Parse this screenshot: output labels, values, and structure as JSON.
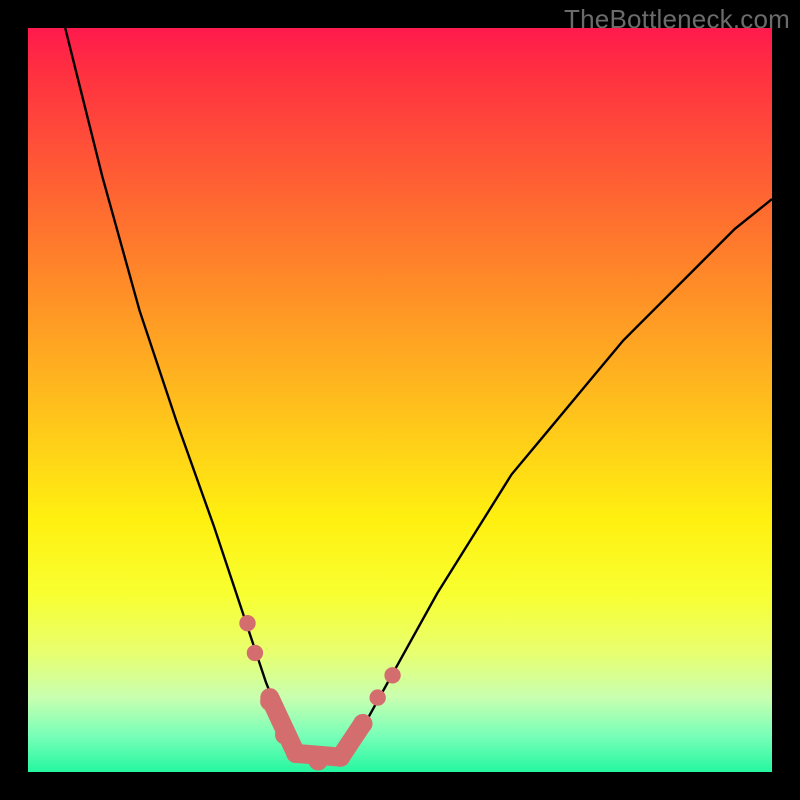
{
  "watermark": "TheBottleneck.com",
  "chart_data": {
    "type": "line",
    "title": "",
    "xlabel": "",
    "ylabel": "",
    "xlim": [
      0,
      100
    ],
    "ylim": [
      0,
      100
    ],
    "grid": false,
    "legend": false,
    "series": [
      {
        "name": "curve",
        "x": [
          5,
          10,
          15,
          20,
          25,
          28,
          30,
          32,
          34,
          36,
          38,
          39,
          40,
          42,
          45,
          50,
          55,
          60,
          65,
          70,
          75,
          80,
          85,
          90,
          95,
          100
        ],
        "values": [
          100,
          80,
          62,
          47,
          33,
          24,
          18,
          12,
          7,
          4,
          2,
          1.5,
          1.5,
          2,
          6,
          15,
          24,
          32,
          40,
          46,
          52,
          58,
          63,
          68,
          73,
          77
        ]
      }
    ],
    "markers": [
      {
        "name": "left-upper-dot",
        "x": 29.5,
        "y": 20,
        "r": 1.1
      },
      {
        "name": "left-mid-dot",
        "x": 30.5,
        "y": 16,
        "r": 1.1
      },
      {
        "name": "left-low1-dot",
        "x": 32.5,
        "y": 9.5,
        "r": 1.3
      },
      {
        "name": "left-low2-dot",
        "x": 34.5,
        "y": 5,
        "r": 1.3
      },
      {
        "name": "trough-start",
        "x": 36,
        "y": 2.5,
        "r": 1.3
      },
      {
        "name": "trough-mid",
        "x": 39,
        "y": 1.5,
        "r": 1.3
      },
      {
        "name": "trough-end",
        "x": 42,
        "y": 2,
        "r": 1.3
      },
      {
        "name": "right-low1-dot",
        "x": 45,
        "y": 6.5,
        "r": 1.3
      },
      {
        "name": "right-low2-dot",
        "x": 47,
        "y": 10,
        "r": 1.1
      },
      {
        "name": "right-upper-dot",
        "x": 49,
        "y": 13,
        "r": 1.1
      }
    ],
    "segments": [
      {
        "name": "left-slope-segment",
        "x1": 32.5,
        "y1": 10,
        "x2": 36,
        "y2": 2.5
      },
      {
        "name": "trough-segment",
        "x1": 36,
        "y1": 2.5,
        "x2": 42,
        "y2": 2
      },
      {
        "name": "right-slope-segment",
        "x1": 42,
        "y1": 2,
        "x2": 45,
        "y2": 6.5
      }
    ]
  }
}
